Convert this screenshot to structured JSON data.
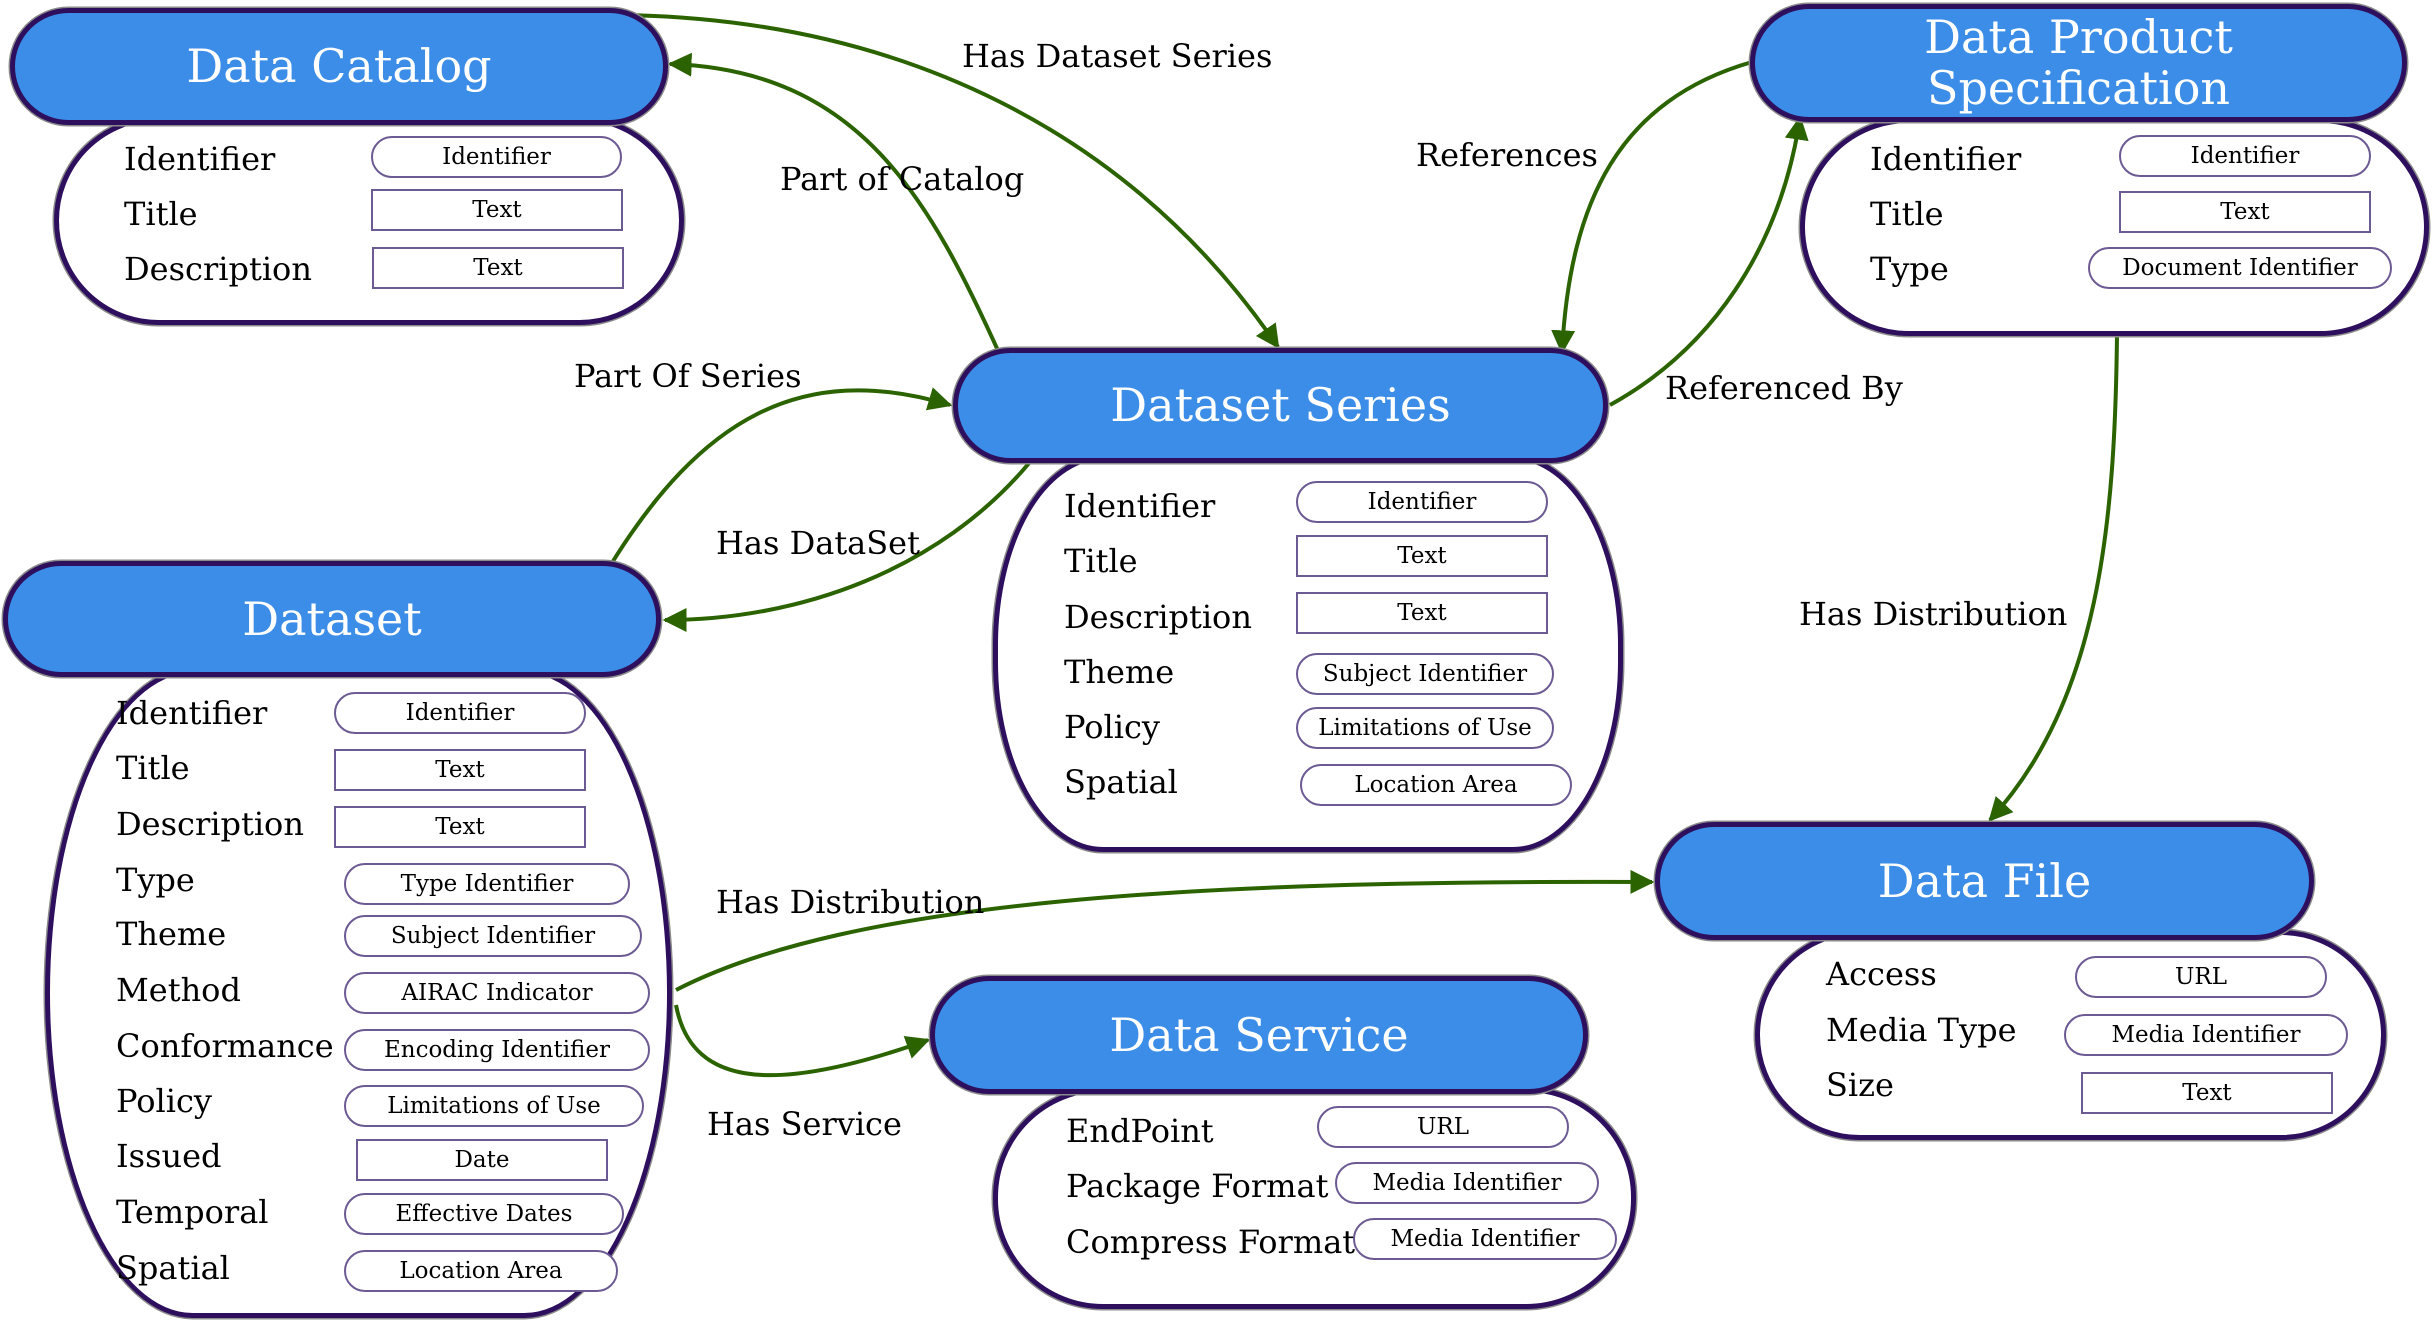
{
  "diagram": {
    "colors": {
      "header_fill": "#3b8de8",
      "node_border": "#2d0f5e",
      "edge_color": "#2b6300",
      "value_border": "#6c5a93"
    },
    "nodes": {
      "data_catalog": {
        "title": "Data Catalog",
        "fields": [
          {
            "label": "Identifier",
            "value": "Identifier",
            "shape": "pill"
          },
          {
            "label": "Title",
            "value": "Text",
            "shape": "rect"
          },
          {
            "label": "Description",
            "value": "Text",
            "shape": "rect"
          }
        ]
      },
      "dataset_series": {
        "title": "Dataset Series",
        "fields": [
          {
            "label": "Identifier",
            "value": "Identifier",
            "shape": "pill"
          },
          {
            "label": "Title",
            "value": "Text",
            "shape": "rect"
          },
          {
            "label": "Description",
            "value": "Text",
            "shape": "rect"
          },
          {
            "label": "Theme",
            "value": "Subject Identifier",
            "shape": "pill"
          },
          {
            "label": "Policy",
            "value": "Limitations of Use",
            "shape": "pill"
          },
          {
            "label": "Spatial",
            "value": "Location Area",
            "shape": "pill"
          }
        ]
      },
      "data_product_spec": {
        "title_line1": "Data Product",
        "title_line2": "Specification",
        "fields": [
          {
            "label": "Identifier",
            "value": "Identifier",
            "shape": "pill"
          },
          {
            "label": "Title",
            "value": "Text",
            "shape": "rect"
          },
          {
            "label": "Type",
            "value": "Document Identifier",
            "shape": "pill"
          }
        ]
      },
      "dataset": {
        "title": "Dataset",
        "fields": [
          {
            "label": "Identifier",
            "value": "Identifier",
            "shape": "pill"
          },
          {
            "label": "Title",
            "value": "Text",
            "shape": "rect"
          },
          {
            "label": "Description",
            "value": "Text",
            "shape": "rect"
          },
          {
            "label": "Type",
            "value": "Type Identifier",
            "shape": "pill"
          },
          {
            "label": "Theme",
            "value": "Subject Identifier",
            "shape": "pill"
          },
          {
            "label": "Method",
            "value": "AIRAC Indicator",
            "shape": "pill"
          },
          {
            "label": "Conformance",
            "value": "Encoding Identifier",
            "shape": "pill"
          },
          {
            "label": "Policy",
            "value": "Limitations of Use",
            "shape": "pill"
          },
          {
            "label": "Issued",
            "value": "Date",
            "shape": "rect"
          },
          {
            "label": "Temporal",
            "value": "Effective Dates",
            "shape": "pill"
          },
          {
            "label": "Spatial",
            "value": "Location Area",
            "shape": "pill"
          }
        ]
      },
      "data_file": {
        "title": "Data File",
        "fields": [
          {
            "label": "Access",
            "value": "URL",
            "shape": "pill"
          },
          {
            "label": "Media Type",
            "value": "Media Identifier",
            "shape": "pill"
          },
          {
            "label": "Size",
            "value": "Text",
            "shape": "rect"
          }
        ]
      },
      "data_service": {
        "title": "Data Service",
        "fields": [
          {
            "label": "EndPoint",
            "value": "URL",
            "shape": "pill"
          },
          {
            "label": "Package Format",
            "value": "Media Identifier",
            "shape": "pill"
          },
          {
            "label": "Compress Format",
            "value": "Media Identifier",
            "shape": "pill"
          }
        ]
      }
    },
    "edges": [
      {
        "id": "has-dataset-series",
        "label": "Has Dataset Series",
        "from": "Data Catalog",
        "to": "Dataset Series"
      },
      {
        "id": "part-of-catalog",
        "label": "Part of Catalog",
        "from": "Dataset Series",
        "to": "Data Catalog"
      },
      {
        "id": "references",
        "label": "References",
        "from": "Data Product Specification",
        "to": "Dataset Series"
      },
      {
        "id": "referenced-by",
        "label": "Referenced By",
        "from": "Dataset Series",
        "to": "Data Product Specification"
      },
      {
        "id": "part-of-series",
        "label": "Part Of Series",
        "from": "Dataset",
        "to": "Dataset Series"
      },
      {
        "id": "has-dataset",
        "label": "Has DataSet",
        "from": "Dataset Series",
        "to": "Dataset"
      },
      {
        "id": "spec-has-distribution",
        "label": "Has Distribution",
        "from": "Data Product Specification",
        "to": "Data File"
      },
      {
        "id": "dataset-has-distribution",
        "label": "Has Distribution",
        "from": "Dataset",
        "to": "Data File"
      },
      {
        "id": "has-service",
        "label": "Has Service",
        "from": "Dataset",
        "to": "Data Service"
      }
    ]
  }
}
